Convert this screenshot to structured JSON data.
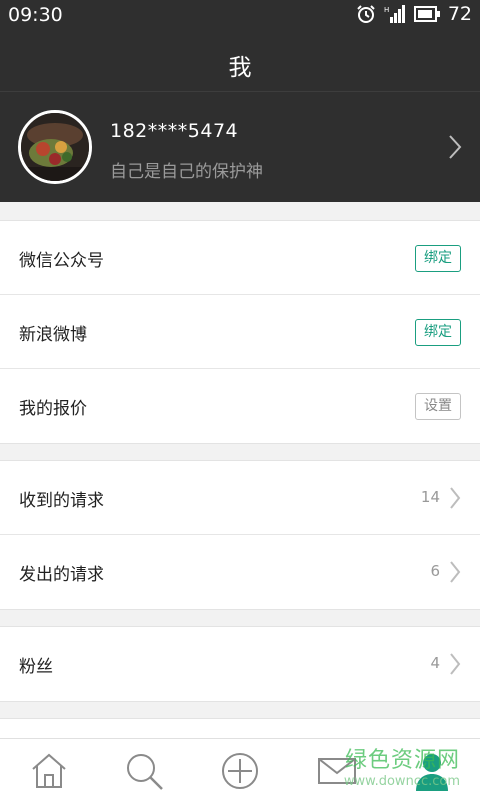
{
  "status_bar": {
    "time": "09:30",
    "battery": "72"
  },
  "header": {
    "title": "我"
  },
  "profile": {
    "phone": "182****5474",
    "signature": "自己是自己的保护神"
  },
  "section1": {
    "items": [
      {
        "label": "微信公众号",
        "action": "绑定"
      },
      {
        "label": "新浪微博",
        "action": "绑定"
      },
      {
        "label": "我的报价",
        "action": "设置"
      }
    ]
  },
  "section2": {
    "items": [
      {
        "label": "收到的请求",
        "count": "14"
      },
      {
        "label": "发出的请求",
        "count": "6"
      }
    ]
  },
  "section3": {
    "items": [
      {
        "label": "粉丝",
        "count": "4"
      }
    ]
  },
  "tab_bar": {
    "icons": [
      "home-icon",
      "search-icon",
      "add-icon",
      "mail-icon",
      "profile-icon"
    ],
    "active": "profile-icon",
    "accent": "#1a9e80"
  },
  "colors": {
    "header_bg": "#2f2f2f",
    "accent_green": "#1a9e80"
  },
  "watermark": {
    "text": "绿色资源网",
    "url": "www.downcc.com"
  }
}
